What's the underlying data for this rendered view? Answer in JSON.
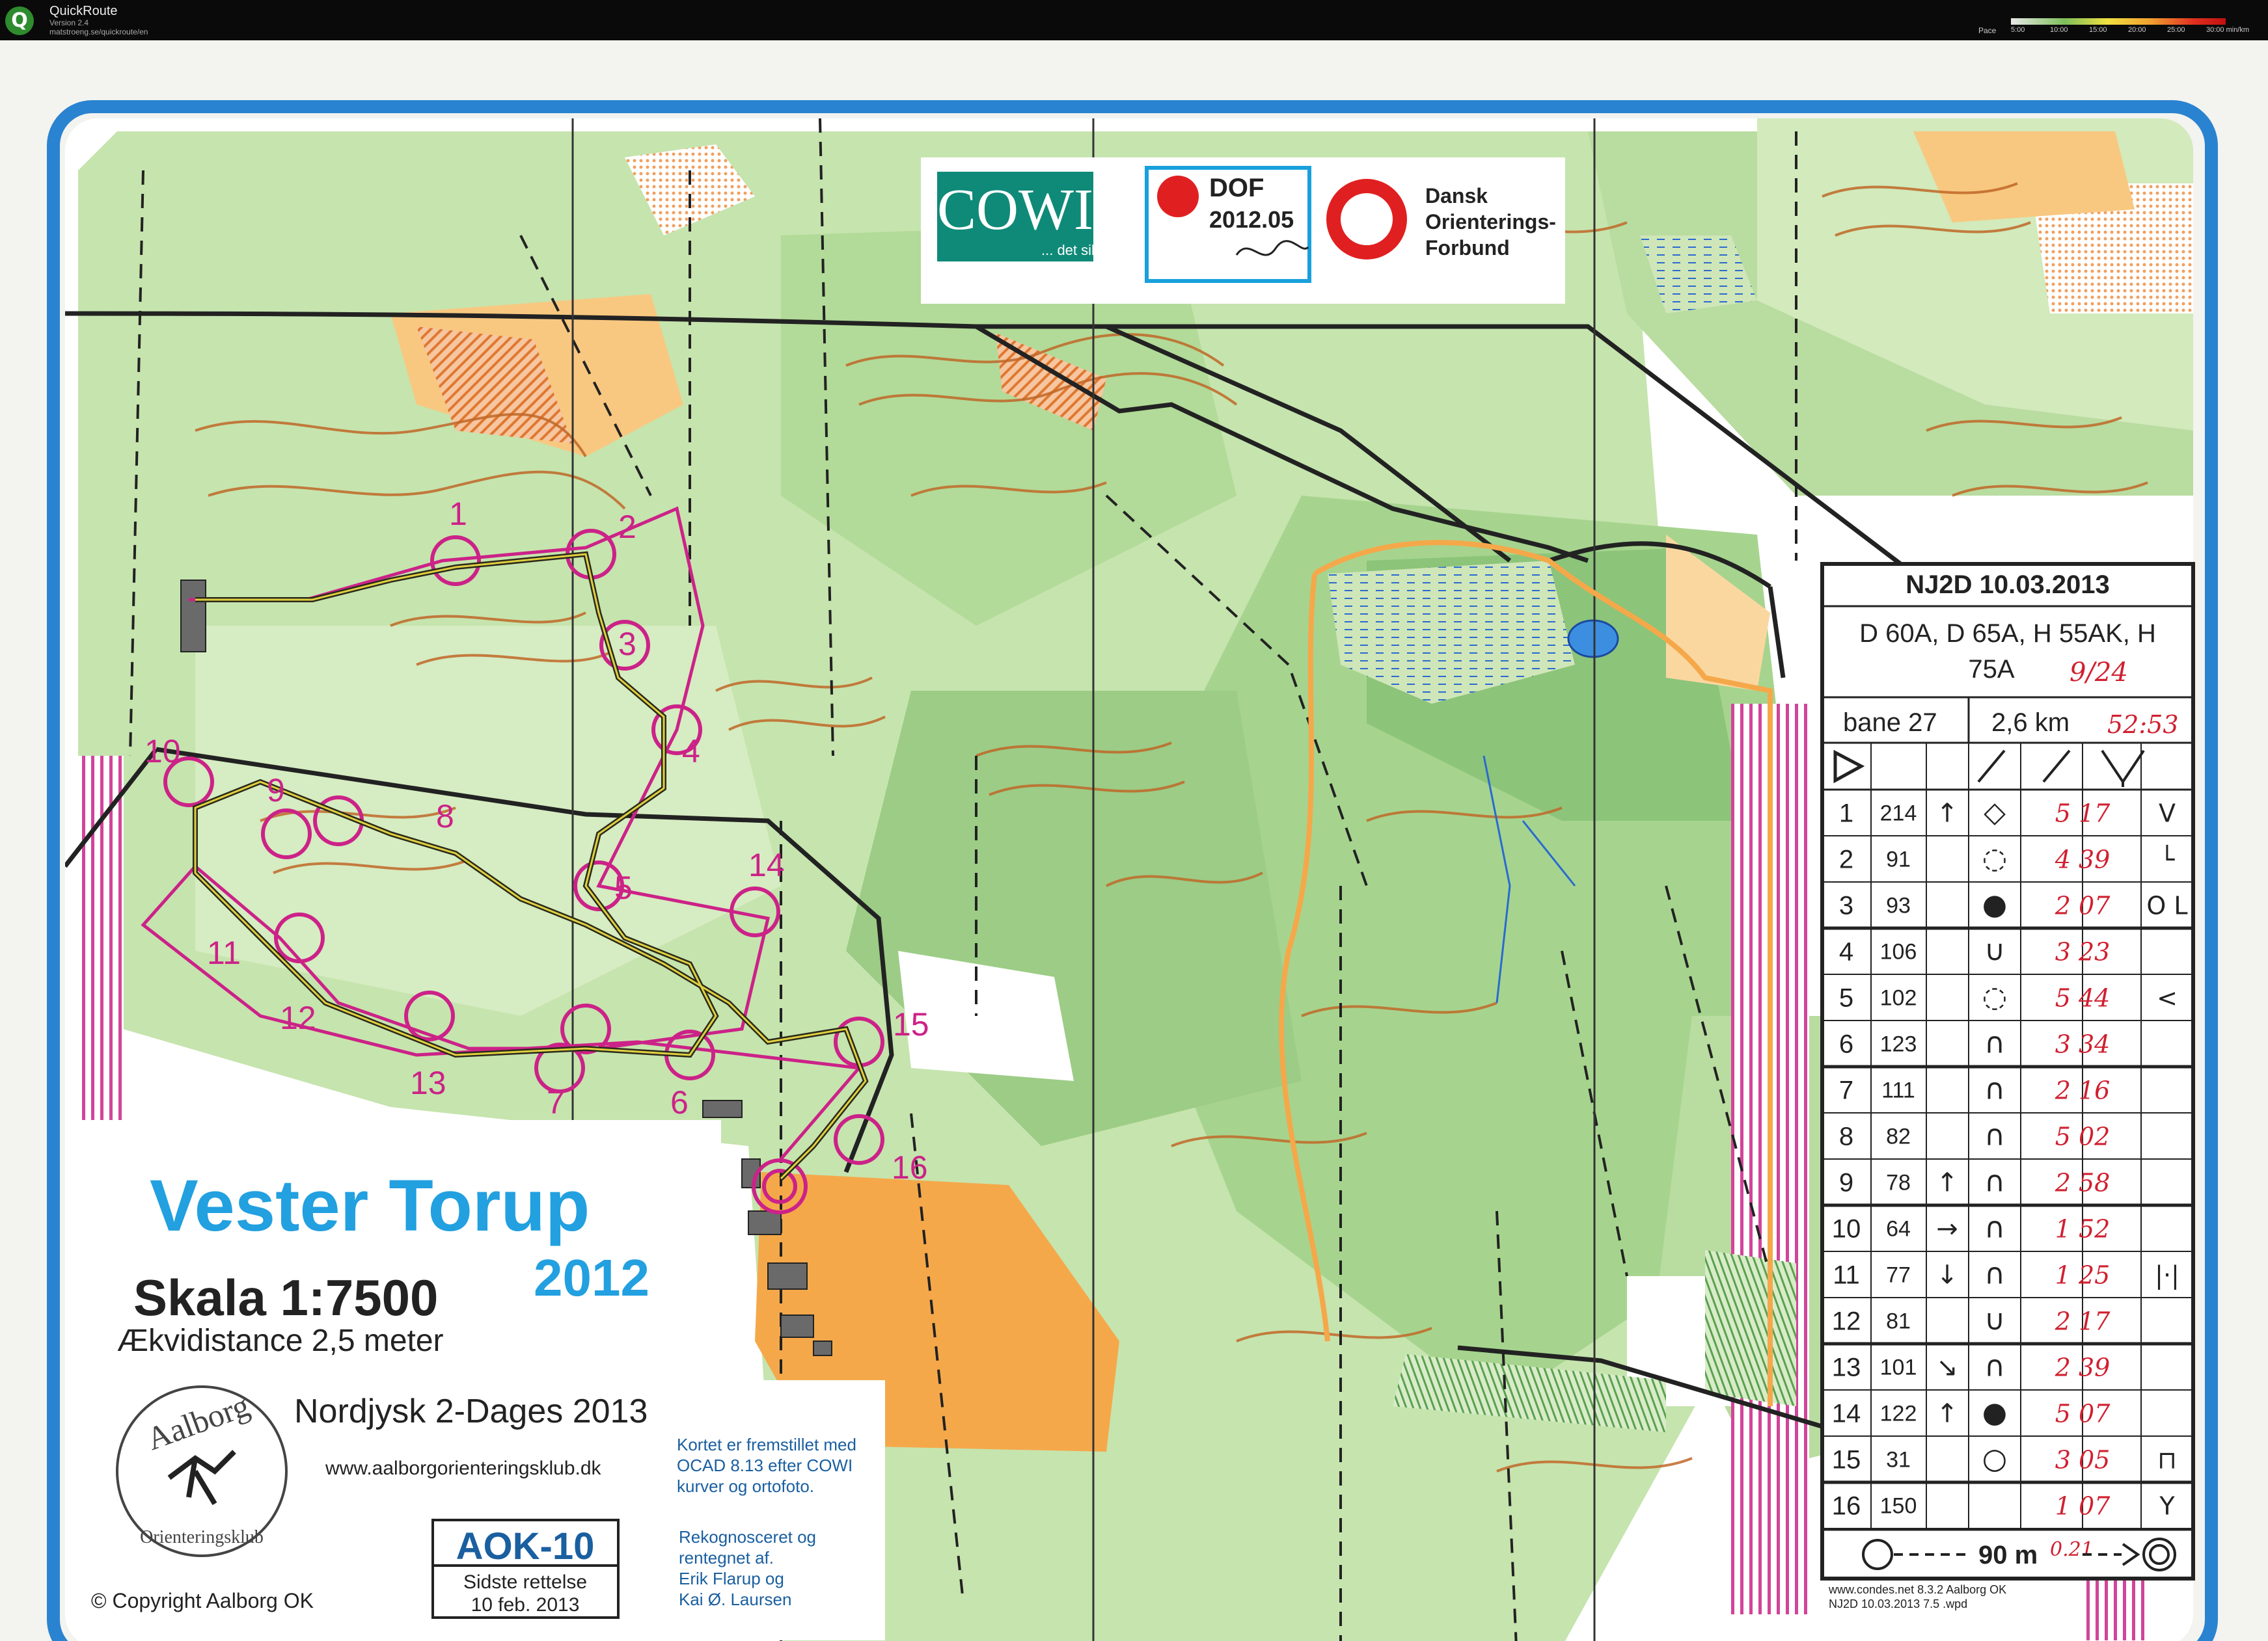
{
  "app": {
    "title": "QuickRoute",
    "version": "Version 2.4",
    "url": "matstroeng.se/quickroute/en",
    "pace_label": "Pace",
    "pace_ticks": [
      "5:00",
      "10:00",
      "15:00",
      "20:00",
      "25:00",
      "30:00 min/km"
    ]
  },
  "map": {
    "title": "Vester Torup",
    "year": "2012",
    "scale": "Skala  1:7500",
    "contour": "Ækvidistance 2,5 meter",
    "event": "Nordjysk 2-Dages 2013",
    "club_url": "www.aalborgorienteringsklub.dk",
    "club_logo_top": "Aalborg",
    "club_logo_bottom": "Orienteringsklub",
    "copyright": "© Copyright  Aalborg OK",
    "map_id": "AOK-10",
    "revision_1": "Sidste rettelse",
    "revision_2": "10 feb. 2013",
    "production_notes": [
      "Kortet er fremstillet med",
      "OCAD 8.13 efter COWI",
      "kurver og ortofoto."
    ],
    "survey_notes": [
      "Rekognosceret og",
      "rentegnet af.",
      "Erik Flarup og",
      "Kai Ø. Laursen"
    ],
    "print_info_1": "www.condes.net 8.3.2 Aalborg OK",
    "print_info_2": "NJ2D 10.03.2013 7.5 .wpd",
    "sponsor_cowi": "COWI",
    "sponsor_cowi_tagline": "... det sikre kort",
    "dof_label_1": "DOF",
    "dof_label_2": "2012.05",
    "federation_1": "Dansk",
    "federation_2": "Orienterings-",
    "federation_3": "Forbund",
    "control_numbers": [
      "1",
      "2",
      "3",
      "4",
      "5",
      "6",
      "7",
      "8",
      "9",
      "10",
      "11",
      "12",
      "13",
      "14",
      "15",
      "16"
    ]
  },
  "description_sheet": {
    "event": "NJ2D 10.03.2013",
    "classes_1": "D 60A, D 65A, H 55AK, H",
    "classes_2": "75A",
    "handwritten_place": "9/24",
    "course": "bane 27",
    "length": "2,6 km",
    "handwritten_total": "52:53",
    "finish_distance": "90 m",
    "handwritten_finish": "0.21",
    "rows": [
      {
        "num": "1",
        "code": "214",
        "dir": "↑",
        "feature": "◇",
        "split": "5 17",
        "extra": "V"
      },
      {
        "num": "2",
        "code": "91",
        "dir": "",
        "feature": "◌",
        "split": "4 39",
        "extra": "└"
      },
      {
        "num": "3",
        "code": "93",
        "dir": "",
        "feature": "●",
        "split": "2 07",
        "extra": "O L"
      },
      {
        "num": "4",
        "code": "106",
        "dir": "",
        "feature": "∪",
        "split": "3 23",
        "extra": ""
      },
      {
        "num": "5",
        "code": "102",
        "dir": "",
        "feature": "◌",
        "split": "5 44",
        "extra": "<"
      },
      {
        "num": "6",
        "code": "123",
        "dir": "",
        "feature": "∩",
        "split": "3 34",
        "extra": ""
      },
      {
        "num": "7",
        "code": "111",
        "dir": "",
        "feature": "∩",
        "split": "2 16",
        "extra": ""
      },
      {
        "num": "8",
        "code": "82",
        "dir": "",
        "feature": "∩",
        "split": "5 02",
        "extra": ""
      },
      {
        "num": "9",
        "code": "78",
        "dir": "↑",
        "feature": "∩",
        "split": "2 58",
        "extra": ""
      },
      {
        "num": "10",
        "code": "64",
        "dir": "→",
        "feature": "∩",
        "split": "1 52",
        "extra": ""
      },
      {
        "num": "11",
        "code": "77",
        "dir": "↓",
        "feature": "∩",
        "split": "1 25",
        "extra": "|·|"
      },
      {
        "num": "12",
        "code": "81",
        "dir": "",
        "feature": "∪",
        "split": "2 17",
        "extra": ""
      },
      {
        "num": "13",
        "code": "101",
        "dir": "↘",
        "feature": "∩",
        "split": "2 39",
        "extra": ""
      },
      {
        "num": "14",
        "code": "122",
        "dir": "↑",
        "feature": "●",
        "split": "5 07",
        "extra": ""
      },
      {
        "num": "15",
        "code": "31",
        "dir": "",
        "feature": "○",
        "split": "3 05",
        "extra": "⊓"
      },
      {
        "num": "16",
        "code": "150",
        "dir": "",
        "feature": "",
        "split": "1 07",
        "extra": "Y"
      }
    ]
  },
  "colors": {
    "border": "#2a83d0",
    "forest_light": "#b9dca0",
    "forest_mid": "#8cc47a",
    "open": "#f8c880",
    "open_bright": "#f5a84a",
    "contour": "#c06828",
    "course": "#cc2288",
    "route": "#2a2a1a",
    "title_blue": "#22a0e0"
  }
}
